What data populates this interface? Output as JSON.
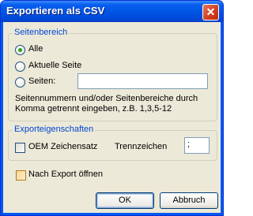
{
  "dialog": {
    "title": "Exportieren als CSV",
    "close_icon": "close-icon"
  },
  "page_range": {
    "legend": "Seitenbereich",
    "options": [
      {
        "label": "Alle",
        "selected": true
      },
      {
        "label": "Aktuelle Seite",
        "selected": false
      },
      {
        "label": "Seiten:",
        "selected": false
      }
    ],
    "pages_value": "",
    "hint": "Seitennummern und/oder Seitenbereiche durch Komma getrennt eingeben, z.B. 1,3,5-12"
  },
  "export_props": {
    "legend": "Exporteigenschaften",
    "oem_label": "OEM Zeichensatz",
    "oem_checked": false,
    "separator_label": "Trennzeichen",
    "separator_value": ";"
  },
  "open_after_export": {
    "label": "Nach Export öffnen",
    "checked": false
  },
  "buttons": {
    "ok": "OK",
    "cancel": "Abbruch"
  }
}
